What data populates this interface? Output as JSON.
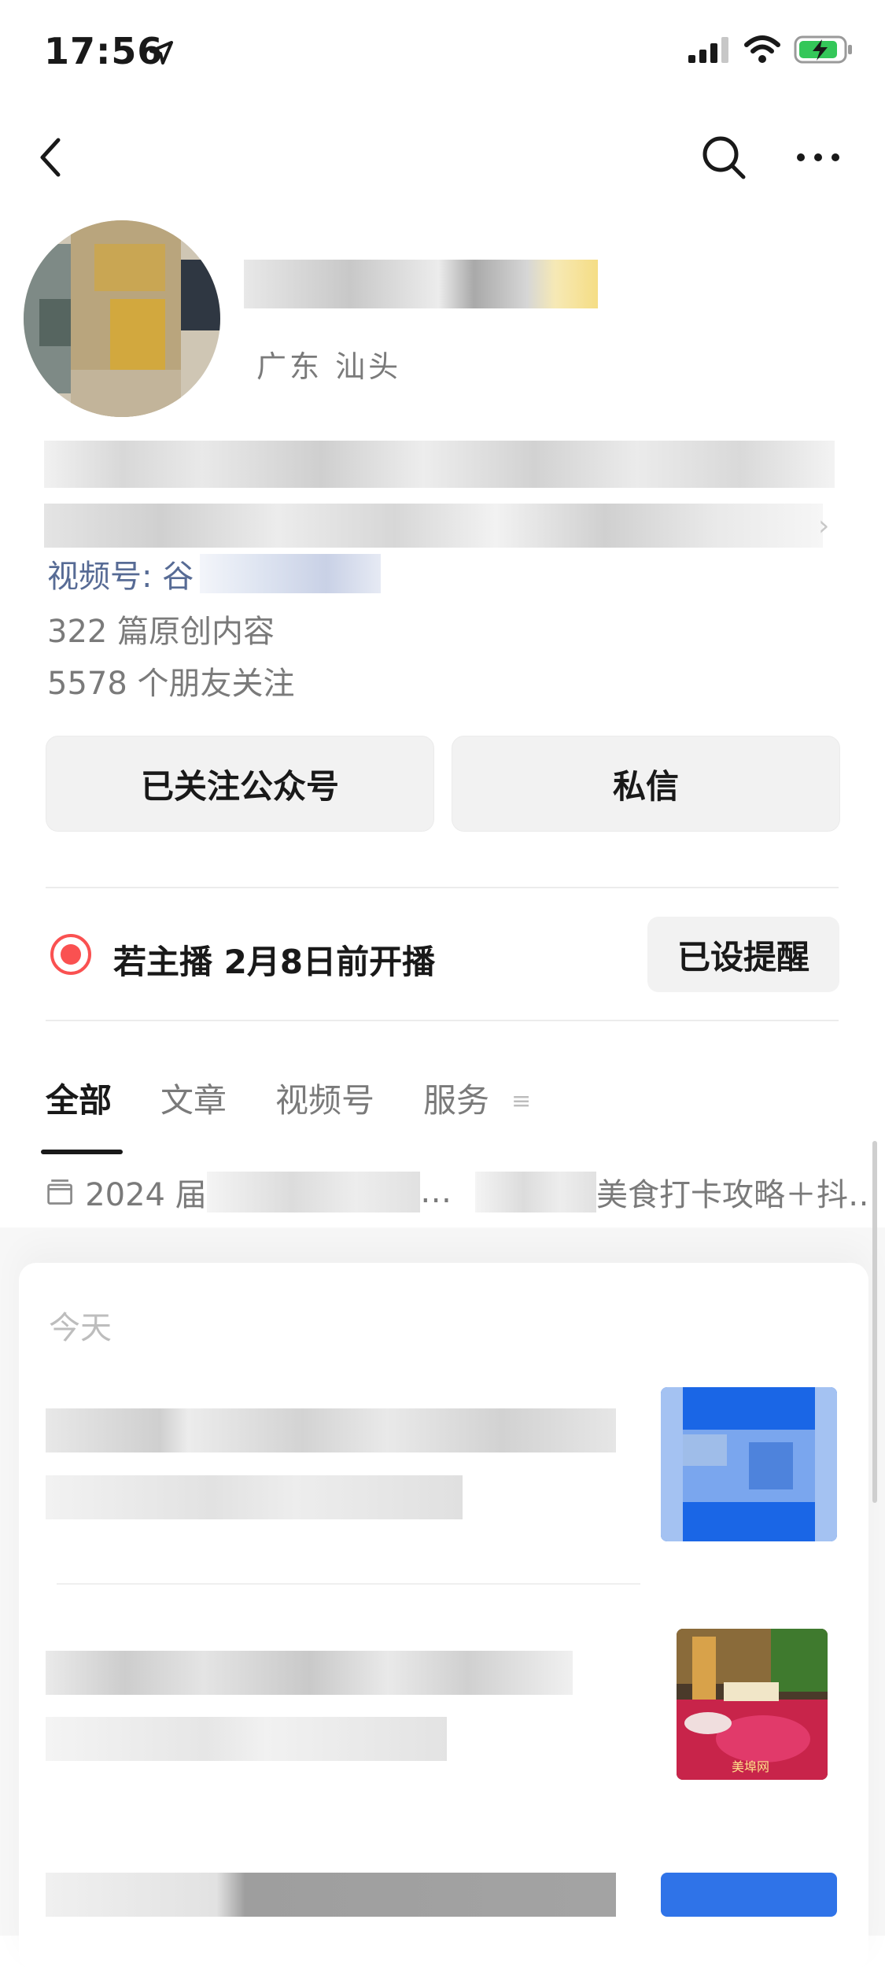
{
  "status_bar": {
    "time": "17:56"
  },
  "profile": {
    "region": "广东 汕头",
    "channel_prefix": "视频号: 谷",
    "original_count": "322 篇原创内容",
    "friends_follow": "5578 个朋友关注"
  },
  "actions": {
    "follow_label": "已关注公众号",
    "message_label": "私信"
  },
  "live": {
    "notice": "若主播 2月8日前开播",
    "remind_label": "已设提醒"
  },
  "tabs": [
    {
      "label": "全部",
      "active": true
    },
    {
      "label": "文章",
      "active": false
    },
    {
      "label": "视频号",
      "active": false
    },
    {
      "label": "服务",
      "active": false
    }
  ],
  "album": {
    "prefix": "2024 届",
    "middle": "…",
    "suffix": "美食打卡攻略＋抖…"
  },
  "feed": {
    "section_label": "今天",
    "thumb2_caption": "美埠网"
  },
  "icons": {
    "back": "chevron-left-icon",
    "search": "search-icon",
    "more": "more-dots-icon",
    "album": "folder-icon"
  },
  "colors": {
    "accent_link": "#576b95",
    "live_red": "#fa5151",
    "thumb_blue": "#1a66e6"
  }
}
